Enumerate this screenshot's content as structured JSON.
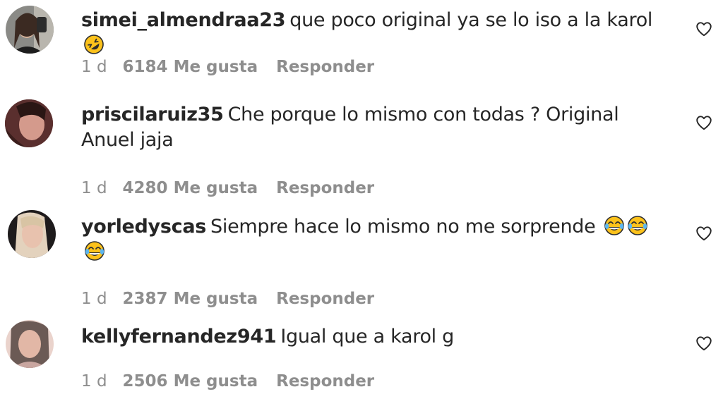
{
  "comments": [
    {
      "username": "simei_almendraa23",
      "text": "que poco original ya se lo iso a la karol",
      "emojis": [
        "rolling-on-floor-laughing"
      ],
      "time": "1 d",
      "likes": "6184 Me gusta",
      "reply": "Responder"
    },
    {
      "username": "priscilaruiz35",
      "text": "Che porque lo mismo con todas ? Original Anuel jaja",
      "emojis": [],
      "time": "1 d",
      "likes": "4280 Me gusta",
      "reply": "Responder"
    },
    {
      "username": "yorledyscas",
      "text": "Siempre hace lo mismo no me sorprende",
      "emojis": [
        "face-with-tears-of-joy",
        "face-with-tears-of-joy",
        "face-with-tears-of-joy"
      ],
      "time": "1 d",
      "likes": "2387 Me gusta",
      "reply": "Responder"
    },
    {
      "username": "kellyfernandez941",
      "text": "Igual que a karol g",
      "emojis": [],
      "time": "1 d",
      "likes": "2506 Me gusta",
      "reply": "Responder"
    }
  ],
  "icons": {
    "like": "heart-outline-icon"
  },
  "colors": {
    "text": "#262626",
    "secondary": "#8e8e8e",
    "emoji": "#fcc21b"
  }
}
